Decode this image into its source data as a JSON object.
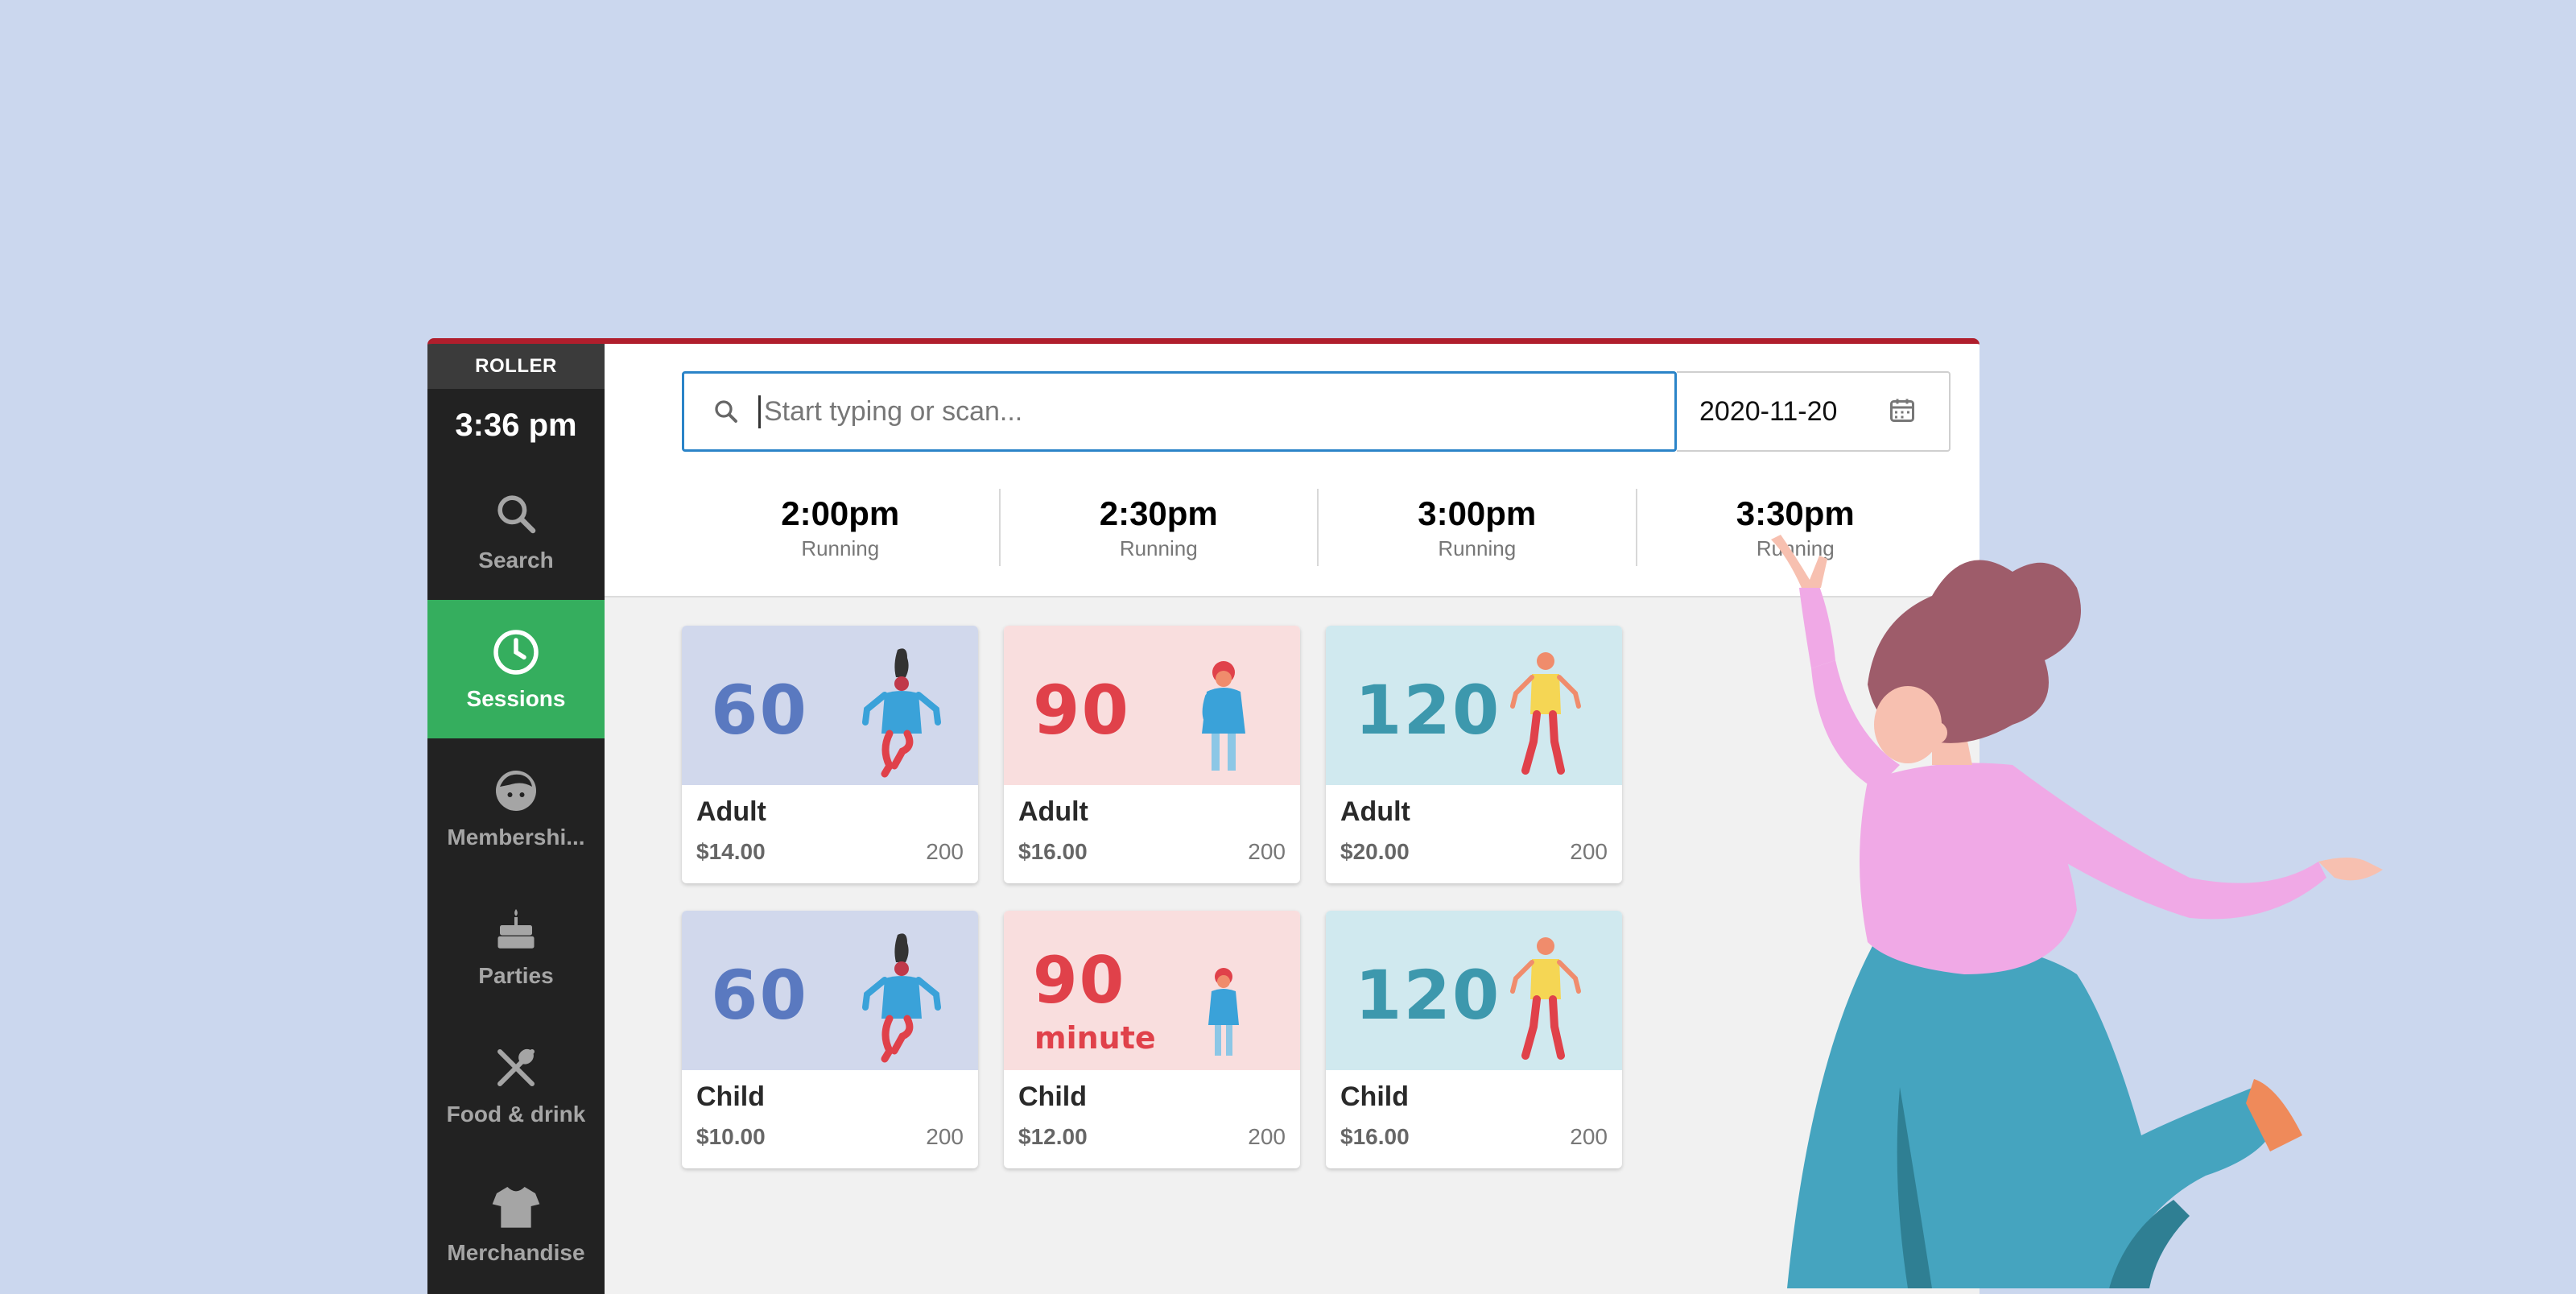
{
  "app": {
    "brand": "ROLLER",
    "clock": "3:36 pm"
  },
  "sidebar": {
    "items": [
      {
        "label": "Search",
        "icon": "search-icon",
        "active": false
      },
      {
        "label": "Sessions",
        "icon": "clock-icon",
        "active": true
      },
      {
        "label": "Membershi...",
        "icon": "face-icon",
        "active": false
      },
      {
        "label": "Parties",
        "icon": "cake-icon",
        "active": false
      },
      {
        "label": "Food & drink",
        "icon": "fork-spoon-icon",
        "active": false
      },
      {
        "label": "Merchandise",
        "icon": "tshirt-icon",
        "active": false
      }
    ]
  },
  "search": {
    "placeholder": "Start typing or scan...",
    "value": ""
  },
  "date": {
    "value": "2020-11-20",
    "icon": "calendar-icon"
  },
  "times": [
    {
      "time": "2:00pm",
      "status": "Running"
    },
    {
      "time": "2:30pm",
      "status": "Running"
    },
    {
      "time": "3:00pm",
      "status": "Running"
    },
    {
      "time": "3:30pm",
      "status": "Running"
    }
  ],
  "cards": [
    {
      "minutes": "60",
      "sub": "",
      "name": "Adult",
      "price": "$14.00",
      "qty": "200"
    },
    {
      "minutes": "90",
      "sub": "",
      "name": "Adult",
      "price": "$16.00",
      "qty": "200"
    },
    {
      "minutes": "120",
      "sub": "",
      "name": "Adult",
      "price": "$20.00",
      "qty": "200"
    },
    {
      "minutes": "60",
      "sub": "",
      "name": "Child",
      "price": "$10.00",
      "qty": "200"
    },
    {
      "minutes": "90",
      "sub": "minute",
      "name": "Child",
      "price": "$12.00",
      "qty": "200"
    },
    {
      "minutes": "120",
      "sub": "",
      "name": "Child",
      "price": "$16.00",
      "qty": "200"
    }
  ],
  "colors": {
    "background": "#cbd7ee",
    "accent_green": "#35ae5e",
    "search_border": "#2b84c8",
    "top_bar": "#b01e2c",
    "card_blue": "#d1d8ec",
    "card_pink": "#f9dede",
    "card_teal": "#d0e9ef",
    "num_blue": "#5a79c0",
    "num_red": "#e0414a",
    "num_teal": "#3d98ad"
  }
}
